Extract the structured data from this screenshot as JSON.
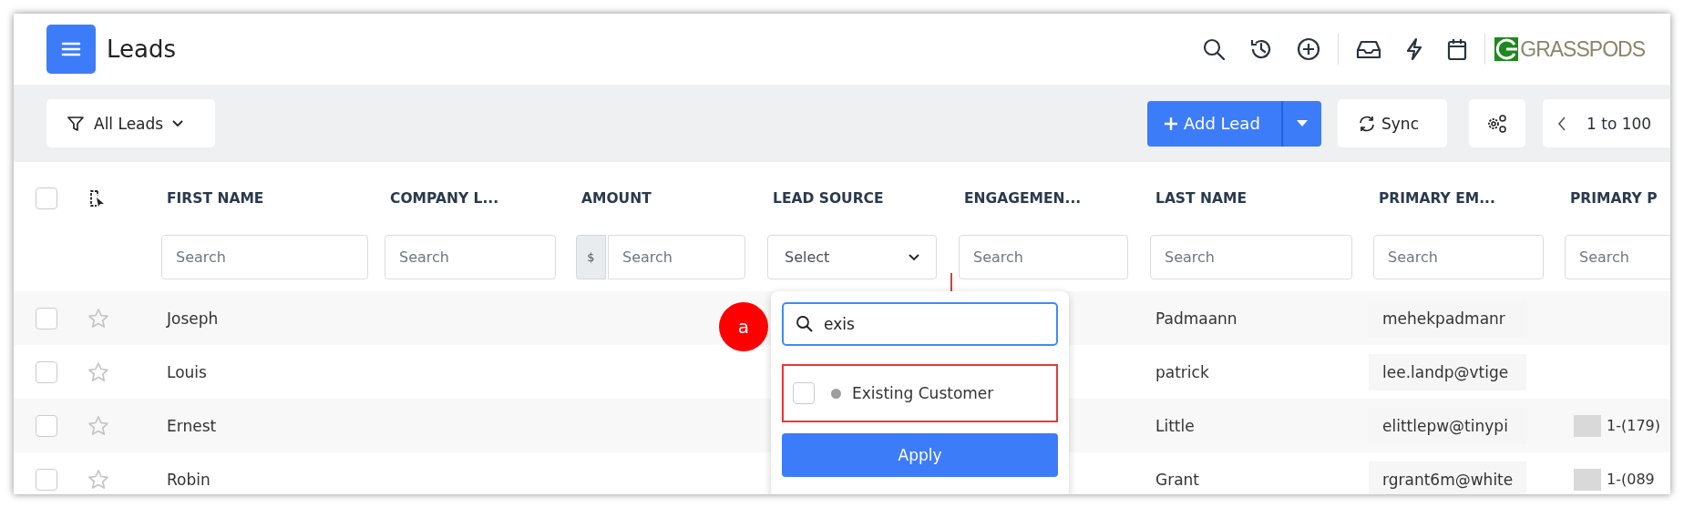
{
  "header": {
    "title": "Leads",
    "logo": "GRASSPODS"
  },
  "toolbar": {
    "filter": "All Leads",
    "add_button": "Add Lead",
    "sync": "Sync",
    "pager": "1 to 100"
  },
  "table": {
    "select_all_checked": false,
    "columns": [
      "FIRST NAME",
      "COMPANY L...",
      "AMOUNT",
      "LEAD SOURCE",
      "ENGAGEMEN...",
      "LAST NAME",
      "PRIMARY EM...",
      "PRIMARY P"
    ],
    "filters": [
      {
        "kind": "search",
        "placeholder": "Search"
      },
      {
        "kind": "search",
        "placeholder": "Search"
      },
      {
        "kind": "currency",
        "prefix": "$",
        "placeholder": "Search"
      },
      {
        "kind": "select",
        "placeholder": "Select"
      },
      {
        "kind": "search",
        "placeholder": "Search"
      },
      {
        "kind": "search",
        "placeholder": "Search"
      },
      {
        "kind": "search",
        "placeholder": "Search"
      },
      {
        "kind": "search",
        "placeholder": "Search"
      }
    ],
    "rows": [
      {
        "checked": false,
        "starred": false,
        "first_name": "Joseph",
        "last_name": "Padmaann",
        "email": "mehekpadmanr"
      },
      {
        "checked": false,
        "starred": false,
        "first_name": "Louis",
        "last_name": "patrick",
        "email": "lee.landp@vtige"
      },
      {
        "checked": false,
        "starred": false,
        "first_name": "Ernest",
        "last_name": "Little",
        "email": "elittlepw@tinypi",
        "phone": "1-(179)"
      },
      {
        "checked": false,
        "starred": false,
        "first_name": "Robin",
        "last_name": "Grant",
        "email": "rgrant6m@white",
        "phone": "1-(089"
      }
    ]
  },
  "lead_source_dropdown": {
    "search_value": "exis",
    "options": [
      {
        "label": "Existing Customer",
        "checked": false,
        "color": "#9e9e9e",
        "highlighted": true
      }
    ],
    "apply": "Apply"
  },
  "annotation": {
    "marker": "a"
  }
}
